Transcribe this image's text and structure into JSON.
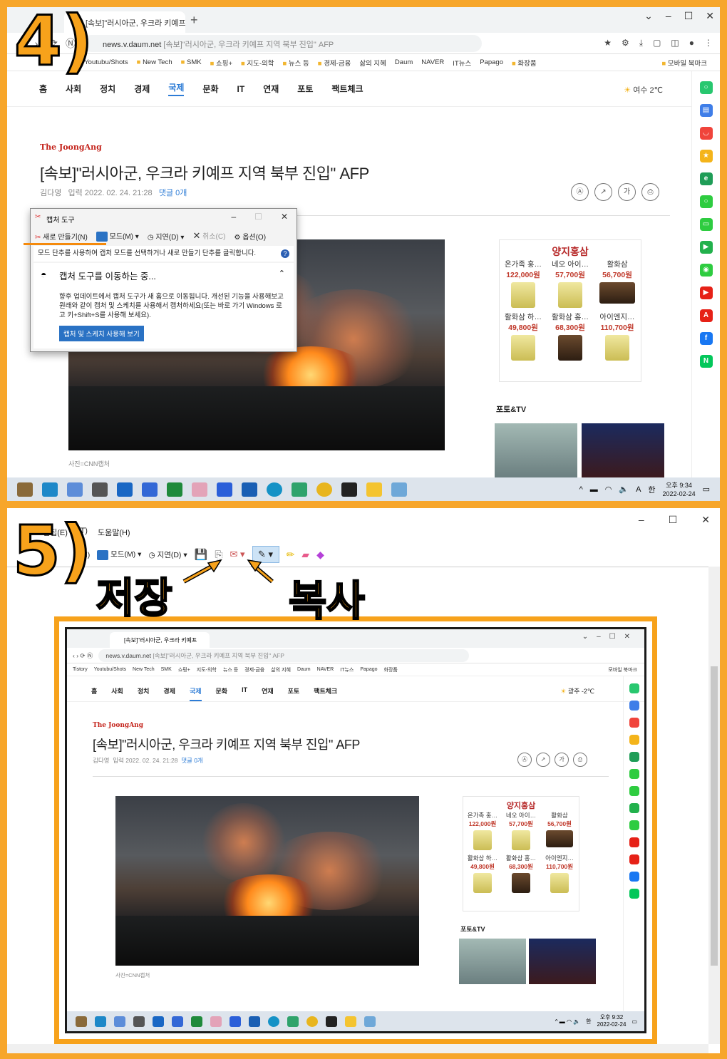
{
  "steps": {
    "s4": "4)",
    "s5": "5)"
  },
  "callouts": {
    "save": "저장",
    "copy": "복사"
  },
  "browser": {
    "tab_title": "[속보]\"러시아군, 우크라 키예프",
    "url_host": "news.v.daum.net",
    "url_rest": "[속보]\"러시아군, 우크라 키예프 지역 북부 진입\" AFP",
    "bookmarks": [
      "Tistory",
      "Youtubu/Shots",
      "New Tech",
      "SMK",
      "쇼핑+",
      "지도-의학",
      "뉴스 등",
      "경제-금융",
      "삶의 지혜",
      "Daum",
      "NAVER",
      "IT뉴스",
      "Papago",
      "화장품"
    ],
    "bookmarks_right": "모바일 북마크"
  },
  "article": {
    "nav": [
      "홈",
      "사회",
      "정치",
      "경제",
      "국제",
      "문화",
      "IT",
      "연재",
      "포토",
      "팩트체크"
    ],
    "active_nav": "국제",
    "weather_top": "여수 2℃",
    "weather_nested": "광주 -2℃",
    "press": "The JoongAng",
    "headline": "[속보]\"러시아군, 우크라 키예프 지역 북부 진입\" AFP",
    "author": "김다영",
    "date": "입력 2022. 02. 24. 21:28",
    "comments": "댓글 0개",
    "tool_font": "가",
    "photo_caption": "사진=CNN캡처",
    "section": "포토&TV"
  },
  "ad": {
    "brand": "양지홍삼",
    "items": [
      {
        "name": "온가족 홍…",
        "price": "122,000원"
      },
      {
        "name": "네오 아이…",
        "price": "57,700원"
      },
      {
        "name": "활화삼",
        "price": "56,700원"
      },
      {
        "name": "활화삼 하…",
        "price": "49,800원"
      },
      {
        "name": "활화삼 홍…",
        "price": "68,300원"
      },
      {
        "name": "아이엔지…",
        "price": "110,700원"
      }
    ]
  },
  "snip": {
    "title": "캡처 도구",
    "new": "새로 만들기(N)",
    "mode": "모드(M)",
    "delay": "지연(D)",
    "cancel": "취소(C)",
    "options": "옵션(O)",
    "hint": "모드 단추를 사용하여 캡처 모드를 선택하거나 새로 만들기 단추를 클릭합니다.",
    "move_title": "캡처 도구를 이동하는 중...",
    "move_body": "향후 업데이트에서 캡처 도구가 새 홈으로 이동됩니다. 개선된 기능을 사용해보고 원래와 같이 캡처 및 스케치를 사용해서 캡처하세요(또는 바로 가기 Windows 로고 키+Shift+S를 사용해 보세요).",
    "move_button": "캡처 및 스케치 사용해 보기"
  },
  "editor": {
    "menu": [
      "편집(E)",
      "(T)",
      "도움말(H)"
    ],
    "new_short": "기(N)",
    "mode": "모드(M)",
    "delay": "지연(D)"
  },
  "taskbar": {
    "ime": "A",
    "ime2": "한",
    "time4": "오후 9:34",
    "date4": "2022-02-24",
    "time5": "오후 9:32",
    "date5": "2022-02-24"
  },
  "colors": {
    "accent": "#f7a21b",
    "frame": "#f7a62b",
    "nav_active": "#2d7cd6",
    "press": "#c4241c"
  }
}
